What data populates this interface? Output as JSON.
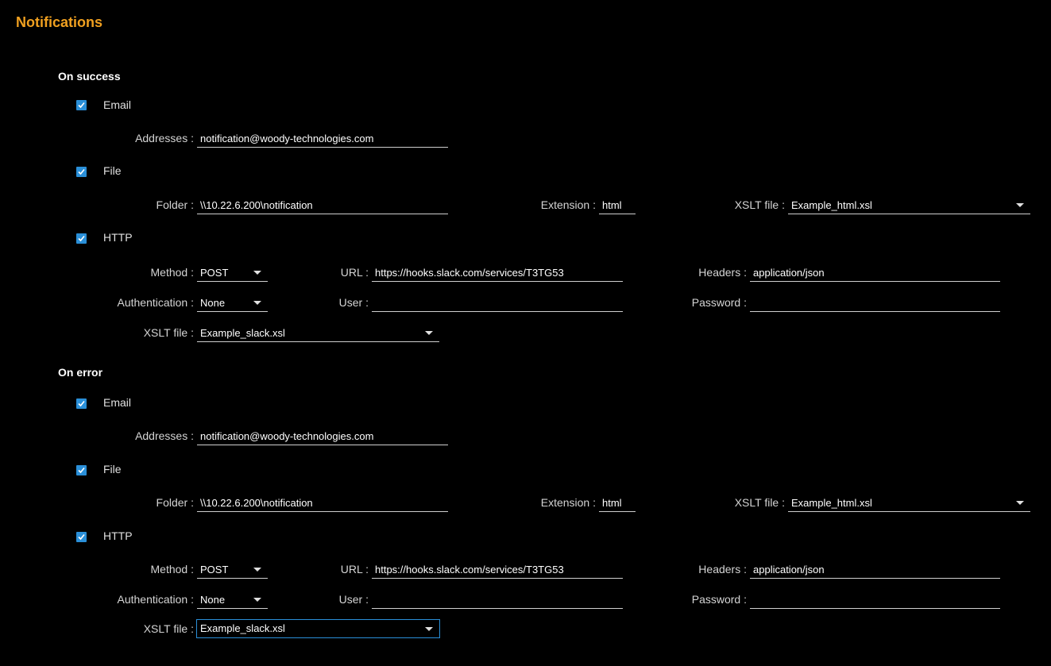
{
  "title": "Notifications",
  "labels": {
    "addresses": "Addresses :",
    "folder": "Folder :",
    "extension": "Extension :",
    "xslt_file": "XSLT file :",
    "method": "Method :",
    "url": "URL :",
    "headers": "Headers :",
    "authentication": "Authentication :",
    "user": "User :",
    "password": "Password :"
  },
  "success": {
    "heading": "On success",
    "email": {
      "label": "Email",
      "checked": true,
      "addresses": "notification@woody-technologies.com"
    },
    "file": {
      "label": "File",
      "checked": true,
      "folder": "\\\\10.22.6.200\\notification",
      "extension": "html",
      "xslt": "Example_html.xsl"
    },
    "http": {
      "label": "HTTP",
      "checked": true,
      "method": "POST",
      "url": "https://hooks.slack.com/services/T3TG53",
      "headers": "application/json",
      "auth": "None",
      "user": "",
      "password": "",
      "xslt": "Example_slack.xsl"
    }
  },
  "error": {
    "heading": "On error",
    "email": {
      "label": "Email",
      "checked": true,
      "addresses": "notification@woody-technologies.com"
    },
    "file": {
      "label": "File",
      "checked": true,
      "folder": "\\\\10.22.6.200\\notification",
      "extension": "html",
      "xslt": "Example_html.xsl"
    },
    "http": {
      "label": "HTTP",
      "checked": true,
      "method": "POST",
      "url": "https://hooks.slack.com/services/T3TG53",
      "headers": "application/json",
      "auth": "None",
      "user": "",
      "password": "",
      "xslt": "Example_slack.xsl"
    }
  },
  "colors": {
    "accent": "#f0a020",
    "checkbox": "#2a8fd8",
    "background": "#000000"
  }
}
